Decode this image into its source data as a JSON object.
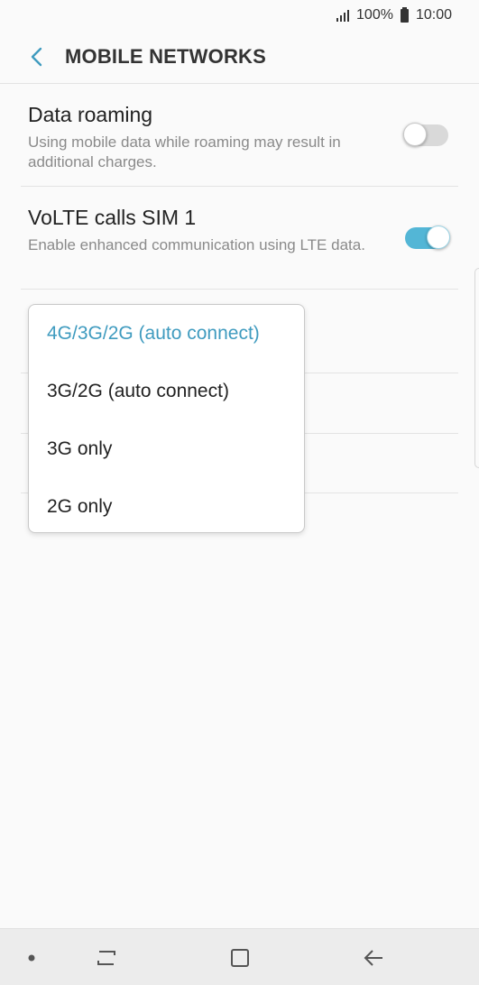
{
  "status_bar": {
    "battery": "100%",
    "time": "10:00"
  },
  "header": {
    "title": "MOBILE NETWORKS"
  },
  "settings": [
    {
      "title": "Data roaming",
      "description": "Using mobile data while roaming may result in additional charges.",
      "enabled": false
    },
    {
      "title": "VoLTE calls SIM 1",
      "description": "Enable enhanced communication using LTE data.",
      "enabled": true
    }
  ],
  "network_mode_menu": {
    "selected": "4G/3G/2G (auto connect)",
    "options": [
      "4G/3G/2G (auto connect)",
      "3G/2G (auto connect)",
      "3G only",
      "2G only"
    ]
  },
  "colors": {
    "accent": "#53b6d6",
    "selected_text": "#3f9bbf",
    "background": "#fafafa"
  },
  "icons": {
    "back": "chevron-left-icon",
    "signal": "signal-icon",
    "battery": "battery-icon",
    "recents": "recents-icon",
    "home": "home-icon",
    "nav_back": "back-arrow-icon"
  }
}
